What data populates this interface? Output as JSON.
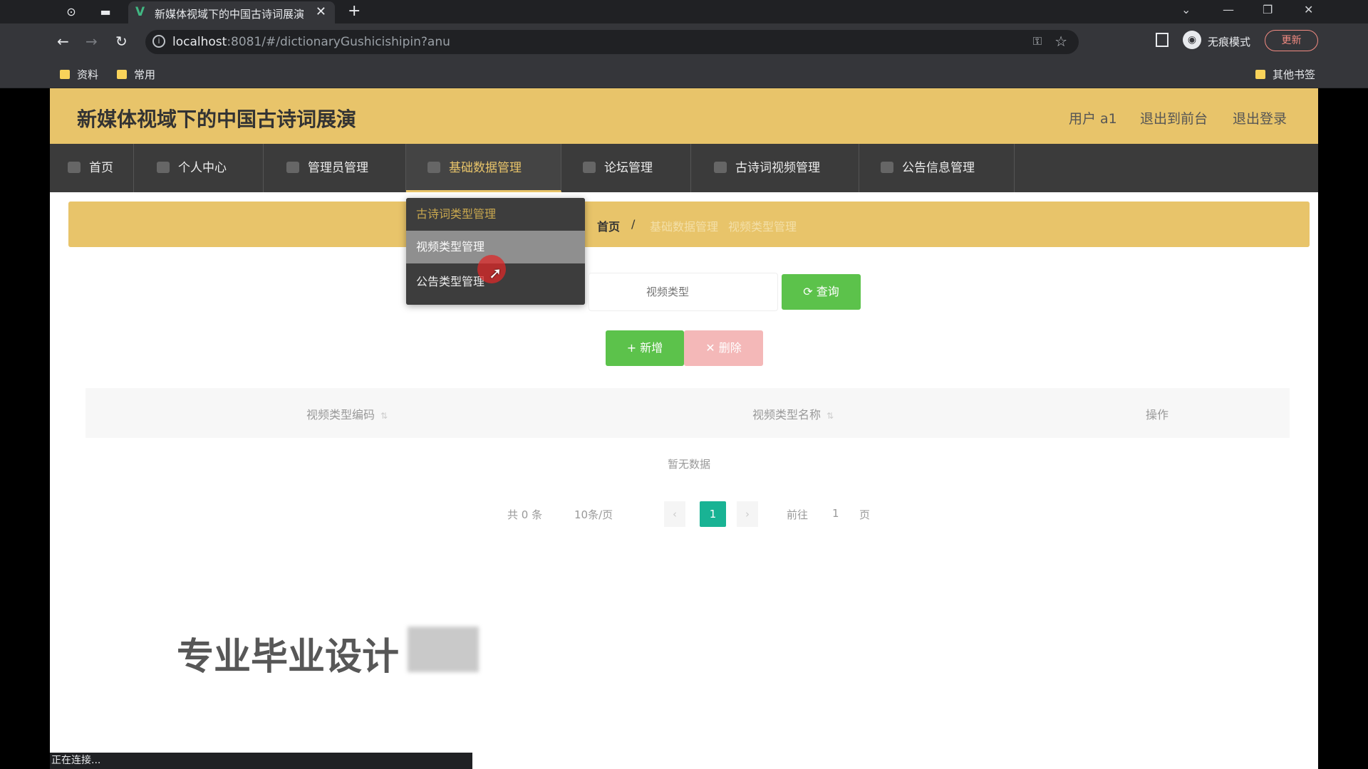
{
  "browser": {
    "tab_title": "新媒体视域下的中国古诗词展演",
    "tab_close": "✕",
    "new_tab": "+",
    "url_host": "localhost",
    "url_rest": ":8081/#/dictionaryGushicishipin?anu",
    "incognito_label": "无痕模式",
    "update_label": "更新",
    "bookmarks": [
      "资料",
      "常用"
    ],
    "other_bookmarks": "其他书签"
  },
  "app": {
    "title": "新媒体视域下的中国古诗词展演",
    "header_links": [
      "用户 a1",
      "退出到前台",
      "退出登录"
    ]
  },
  "menu": {
    "items": [
      {
        "label": "首页",
        "icon": "home-icon"
      },
      {
        "label": "个人中心",
        "icon": "user-icon"
      },
      {
        "label": "管理员管理",
        "icon": "flag-icon"
      },
      {
        "label": "基础数据管理",
        "icon": "database-icon"
      },
      {
        "label": "论坛管理",
        "icon": "forum-icon"
      },
      {
        "label": "古诗词视频管理",
        "icon": "video-icon"
      },
      {
        "label": "公告信息管理",
        "icon": "notice-icon"
      }
    ]
  },
  "dropdown": {
    "items": [
      "古诗词类型管理",
      "视频类型管理",
      "公告类型管理"
    ]
  },
  "breadcrumb": {
    "home": "首页",
    "separator": "/",
    "level1": "基础数据管理",
    "level2": "视频类型管理"
  },
  "search": {
    "placeholder": "视频类型",
    "query_button": "⟳ 查询"
  },
  "actions": {
    "add_button": "+ 新增",
    "delete_button": "✕ 删除"
  },
  "table": {
    "columns": [
      "视频类型编码",
      "视频类型名称",
      "操作"
    ],
    "empty_text": "暂无数据"
  },
  "pagination": {
    "total": "共 0 条",
    "page_size": "10条/页",
    "current_page": "1",
    "goto_label": "前往",
    "goto_value": "1",
    "page_suffix": "页"
  },
  "overlay": {
    "watermark": "专业毕业设计"
  },
  "status": {
    "text": "正在连接..."
  }
}
